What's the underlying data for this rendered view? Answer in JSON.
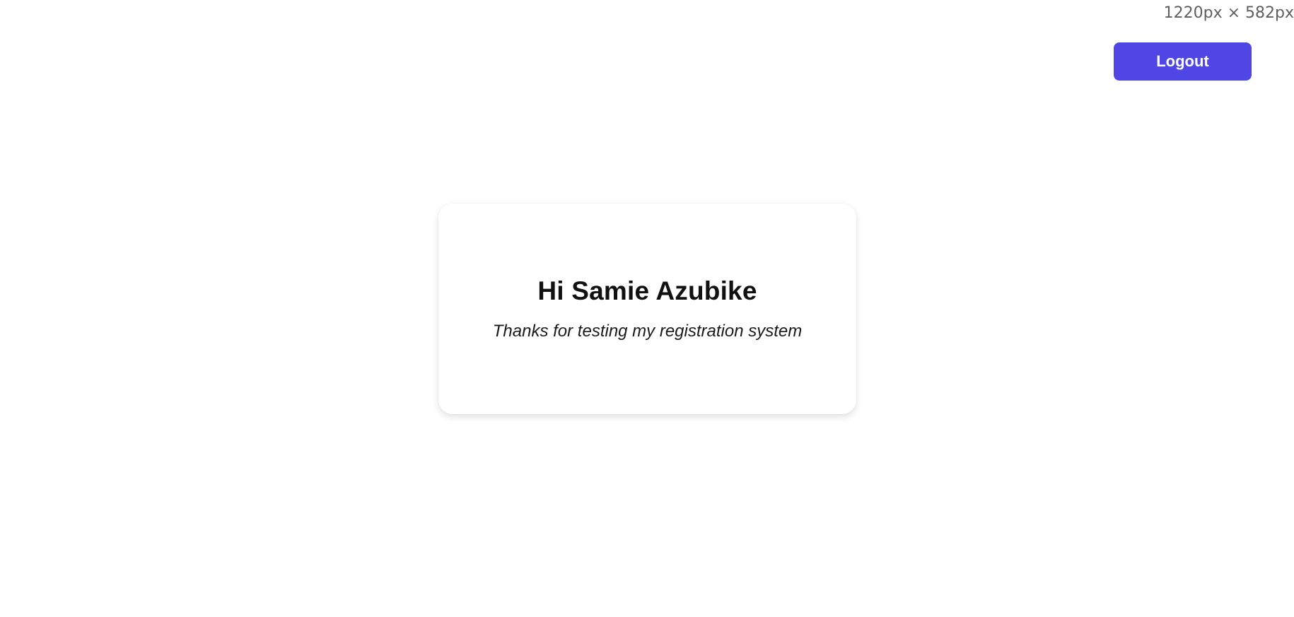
{
  "viewport_readout": "1220px × 582px",
  "header": {
    "logout_label": "Logout"
  },
  "card": {
    "greeting": "Hi Samie Azubike",
    "message": "Thanks for testing my registration system"
  },
  "colors": {
    "accent": "#4f46e5",
    "background": "#ffffff",
    "text": "#111111"
  }
}
